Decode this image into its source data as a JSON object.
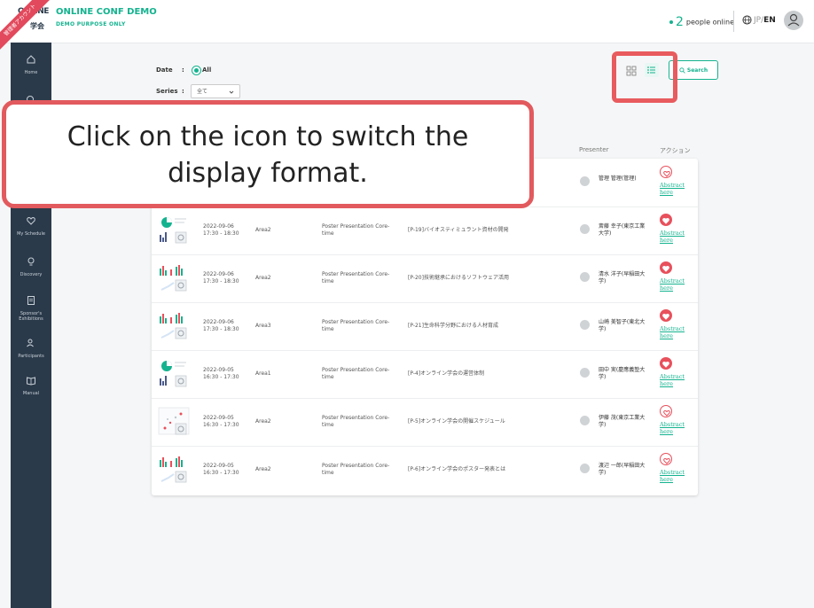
{
  "header": {
    "title": "ONLINE CONF DEMO",
    "subtitle": "DEMO PURPOSE ONLY",
    "logo_line1": "ONLINE",
    "logo_line2": "学会",
    "ribbon_text": "管理者アカウント",
    "online_count": "2",
    "online_label": "people online",
    "lang_jp": "JP",
    "lang_sep": "/",
    "lang_en": "EN"
  },
  "sidebar": {
    "items": [
      {
        "label": "Home",
        "icon": "home-icon"
      },
      {
        "label": "",
        "icon": "search-icon"
      },
      {
        "label": "My Schedule",
        "icon": "heart-icon"
      },
      {
        "label": "Discovery",
        "icon": "bulb-icon"
      },
      {
        "label": "Sponsor's Exhibitions",
        "icon": "document-icon"
      },
      {
        "label": "Participants",
        "icon": "people-icon"
      },
      {
        "label": "Manual",
        "icon": "book-icon"
      }
    ]
  },
  "filters": {
    "date_label": "Date",
    "date_colon": ":",
    "date_value": "All",
    "series_label": "Series",
    "series_colon": ":",
    "series_value": "全て"
  },
  "toolbar": {
    "search_label": "Search"
  },
  "table": {
    "headers": {
      "presenter": "Presenter",
      "action": "アクション"
    },
    "rows": [
      {
        "date": "",
        "time": "",
        "area": "",
        "type": "",
        "title": "",
        "presenter": "管理 管理(管理)",
        "fav": false,
        "abstract": "Abstract here",
        "thumb": "pie"
      },
      {
        "date": "2022-09-06",
        "time": "17:30 - 18:30",
        "area": "Area2",
        "type": "Poster Presentation Core-time",
        "title": "[P-19]バイオスティミュラント資材の開発",
        "presenter": "斎藤 幸子(東京工業大学)",
        "fav": true,
        "abstract": "Abstract here",
        "thumb": "pie"
      },
      {
        "date": "2022-09-06",
        "time": "17:30 - 18:30",
        "area": "Area2",
        "type": "Poster Presentation Core-time",
        "title": "[P-20]技術継承におけるソフトウェア活用",
        "presenter": "清水 洋子(早稲田大学)",
        "fav": true,
        "abstract": "Abstract here",
        "thumb": "bars"
      },
      {
        "date": "2022-09-06",
        "time": "17:30 - 18:30",
        "area": "Area3",
        "type": "Poster Presentation Core-time",
        "title": "[P-21]生命科学分野における人材育成",
        "presenter": "山崎 美智子(東北大学)",
        "fav": true,
        "abstract": "Abstract here",
        "thumb": "bars"
      },
      {
        "date": "2022-09-05",
        "time": "16:30 - 17:30",
        "area": "Area1",
        "type": "Poster Presentation Core-time",
        "title": "[P-4]オンライン学会の運営体制",
        "presenter": "田中 実(慶應義塾大学)",
        "fav": true,
        "abstract": "Abstract here",
        "thumb": "pie"
      },
      {
        "date": "2022-09-05",
        "time": "16:30 - 17:30",
        "area": "Area2",
        "type": "Poster Presentation Core-time",
        "title": "[P-5]オンライン学会の開催スケジュール",
        "presenter": "伊藤 茂(東京工業大学)",
        "fav": false,
        "abstract": "Abstract here",
        "thumb": "scatter"
      },
      {
        "date": "2022-09-05",
        "time": "16:30 - 17:30",
        "area": "Area2",
        "type": "Poster Presentation Core-time",
        "title": "[P-6]オンライン学会のポスター発表とは",
        "presenter": "渡辺 一郎(早稲田大学)",
        "fav": false,
        "abstract": "Abstract here",
        "thumb": "bars"
      }
    ]
  },
  "callout": {
    "line1": "Click on the icon to switch the",
    "line2": "display format."
  },
  "colors": {
    "accent": "#14b38f",
    "callout_border": "#e25a5e",
    "sidebar": "#2b3a4a",
    "heart": "#e8505b"
  }
}
